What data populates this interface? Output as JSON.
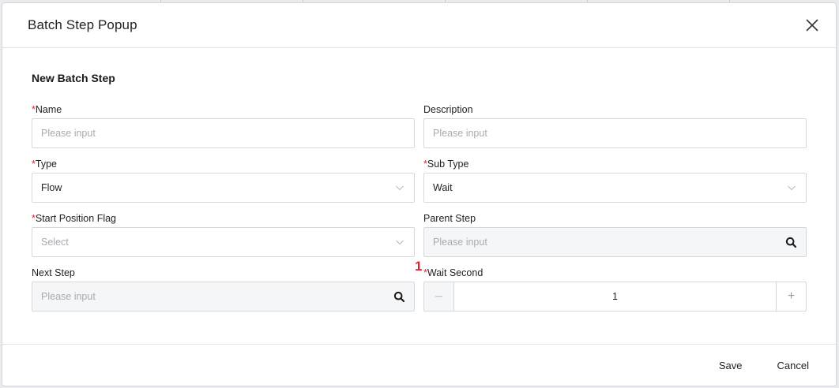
{
  "modal": {
    "title": "Batch Step Popup",
    "section_title": "New Batch Step"
  },
  "fields": {
    "name": {
      "label": "Name",
      "required": "*",
      "placeholder": "Please input"
    },
    "description": {
      "label": "Description",
      "placeholder": "Please input"
    },
    "type": {
      "label": "Type",
      "required": "*",
      "value": "Flow"
    },
    "sub_type": {
      "label": "Sub Type",
      "required": "*",
      "value": "Wait"
    },
    "start_position_flag": {
      "label": "Start Position Flag",
      "required": "*",
      "placeholder": "Select"
    },
    "parent_step": {
      "label": "Parent Step",
      "placeholder": "Please input"
    },
    "next_step": {
      "label": "Next Step",
      "placeholder": "Please input"
    },
    "wait_second": {
      "label": "Wait Second",
      "required": "*",
      "value": "1",
      "marker": "1",
      "minus": "–",
      "plus": "+"
    }
  },
  "footer": {
    "save_label": "Save",
    "cancel_label": "Cancel"
  },
  "icons": {
    "close": "close-icon",
    "chevron": "chevron-down-icon",
    "search": "search-icon"
  },
  "colors": {
    "required": "#e0242d",
    "placeholder": "#a8abb0"
  }
}
